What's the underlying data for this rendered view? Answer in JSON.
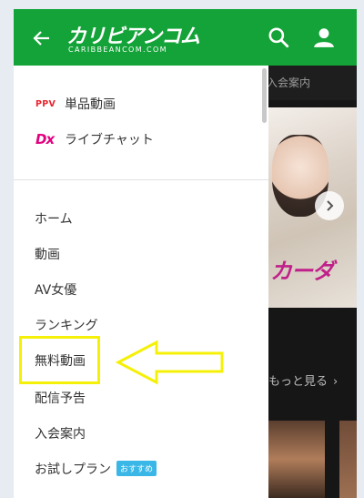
{
  "colors": {
    "brand_green": "#14a338",
    "ppv_red": "#e8262f",
    "dx_pink": "#e3007f",
    "badge_blue": "#3ab7e7",
    "highlight_yellow": "#f5f007"
  },
  "drawer": {
    "logo_text": "カリビアンコム",
    "logo_sub": "CARIBBEANCOM.COM",
    "back_icon": "arrow-left-icon",
    "featured": [
      {
        "icon_label": "PPV",
        "label": "単品動画"
      },
      {
        "icon_label": "Dx",
        "label": "ライブチャット"
      }
    ],
    "nav": [
      {
        "label": "ホーム"
      },
      {
        "label": "動画"
      },
      {
        "label": "AV女優"
      },
      {
        "label": "ランキング"
      },
      {
        "label": "無料動画"
      },
      {
        "label": "配信予告"
      },
      {
        "label": "入会案内"
      },
      {
        "label": "お試しプラン",
        "badge": "おすすめ"
      }
    ]
  },
  "background": {
    "header_icons": [
      "search-icon",
      "user-icon"
    ],
    "subnav_text": "入会案内",
    "banner_title": "カーダ",
    "more_link": "もっと見る"
  },
  "annotation": {
    "highlighted_item": "無料動画"
  }
}
